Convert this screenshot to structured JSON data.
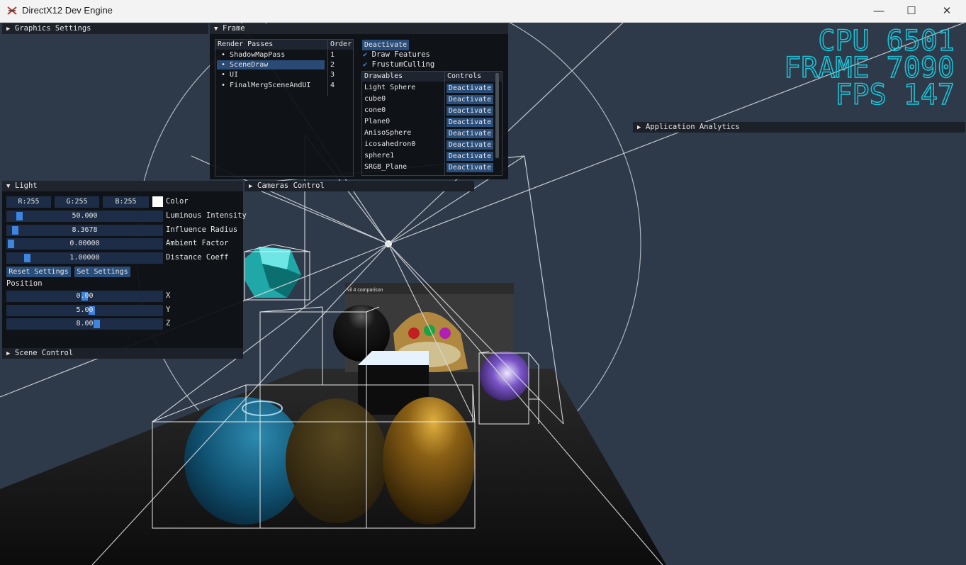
{
  "window": {
    "title": "DirectX12 Dev Engine",
    "minimize": "—",
    "maximize": "☐",
    "close": "✕"
  },
  "hud": {
    "cpu": "CPU 6501",
    "frame": "FRAME 7090",
    "fps": "FPS 147",
    "color": "#18c8dc"
  },
  "panels": {
    "graphics_settings": "Graphics Settings",
    "application_analytics": "Application Analytics",
    "cameras_control": "Cameras Control",
    "scene_control": "Scene Control"
  },
  "frame": {
    "title": "Frame",
    "render_passes_header": "Render Passes",
    "order_header": "Order",
    "passes": [
      {
        "name": "ShadowMapPass",
        "order": "1"
      },
      {
        "name": "SceneDraw",
        "order": "2"
      },
      {
        "name": "UI",
        "order": "3"
      },
      {
        "name": "FinalMergSceneAndUI",
        "order": "4"
      }
    ],
    "deactivate_button": "Deactivate",
    "draw_features": "Draw Features",
    "frustum_culling": "FrustumCulling",
    "drawables_header": "Drawables",
    "controls_header": "Controls",
    "drawables": [
      {
        "name": "Light Sphere",
        "action": "Deactivate"
      },
      {
        "name": "cube0",
        "action": "Deactivate"
      },
      {
        "name": "cone0",
        "action": "Deactivate"
      },
      {
        "name": "Plane0",
        "action": "Deactivate"
      },
      {
        "name": "AnisoSphere",
        "action": "Deactivate"
      },
      {
        "name": "icosahedron0",
        "action": "Deactivate"
      },
      {
        "name": "sphere1",
        "action": "Deactivate"
      },
      {
        "name": "SRGB_Plane",
        "action": "Deactivate"
      }
    ]
  },
  "light": {
    "title": "Light",
    "r": "R:255",
    "g": "G:255",
    "b": "B:255",
    "color_label": "Color",
    "sliders": [
      {
        "value": "50.000",
        "label": "Luminous Intensity",
        "level": 0.06
      },
      {
        "value": "8.3678",
        "label": "Influence Radius",
        "level": 0.03
      },
      {
        "value": "0.00000",
        "label": "Ambient Factor",
        "level": 0.0
      },
      {
        "value": "1.00000",
        "label": "Distance Coeff",
        "level": 0.11
      }
    ],
    "reset_button": "Reset Settings",
    "set_button": "Set Settings",
    "position_label": "Position",
    "position": [
      {
        "value": "0.00",
        "axis": "X",
        "level": 0.5
      },
      {
        "value": "5.00",
        "axis": "Y",
        "level": 0.55
      },
      {
        "value": "8.00",
        "axis": "Z",
        "level": 0.58
      }
    ]
  },
  "scene_texture": {
    "caption": "vil 4 comparison"
  }
}
